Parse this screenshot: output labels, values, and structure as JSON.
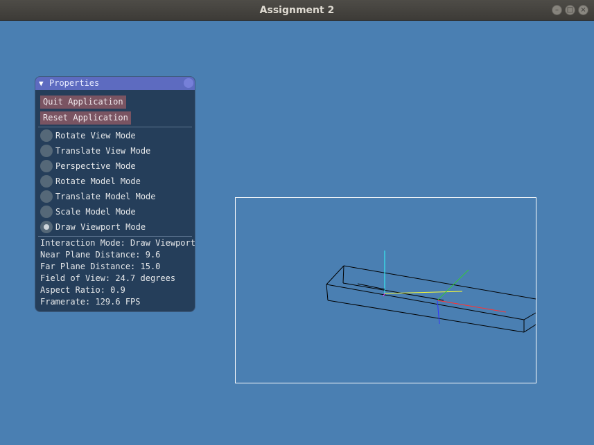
{
  "window": {
    "title": "Assignment 2",
    "controls": {
      "minimize_glyph": "–",
      "maximize_glyph": "□",
      "close_glyph": "×"
    }
  },
  "panel": {
    "title": "Properties",
    "collapse_glyph": "▼",
    "buttons": {
      "quit": "Quit Application",
      "reset": "Reset Application"
    },
    "modes": [
      {
        "label": "Rotate View Mode",
        "selected": false
      },
      {
        "label": "Translate View Mode",
        "selected": false
      },
      {
        "label": "Perspective Mode",
        "selected": false
      },
      {
        "label": "Rotate Model Mode",
        "selected": false
      },
      {
        "label": "Translate Model Mode",
        "selected": false
      },
      {
        "label": "Scale Model Mode",
        "selected": false
      },
      {
        "label": "Draw Viewport Mode",
        "selected": true
      }
    ],
    "info": {
      "interaction_mode": "Interaction Mode: Draw Viewport",
      "near_plane": "Near Plane Distance: 9.6",
      "far_plane": "Far Plane Distance: 15.0",
      "fov": "Field of View: 24.7 degrees",
      "aspect": "Aspect Ratio: 0.9",
      "framerate": "Framerate: 129.6 FPS"
    }
  },
  "colors": {
    "background": "#4a7fb2",
    "panel_bg": "#253e5a",
    "header": "#5d6bc0",
    "button": "#7a5462",
    "viewport_border": "#ffffff",
    "axis_x": "#ffff33",
    "axis_y": "#33ffff",
    "axis_z": "#ff33ff",
    "model_axis_x": "#ff3333",
    "model_axis_y": "#33cc33",
    "model_axis_z": "#3333ff",
    "cube": "#000000"
  }
}
